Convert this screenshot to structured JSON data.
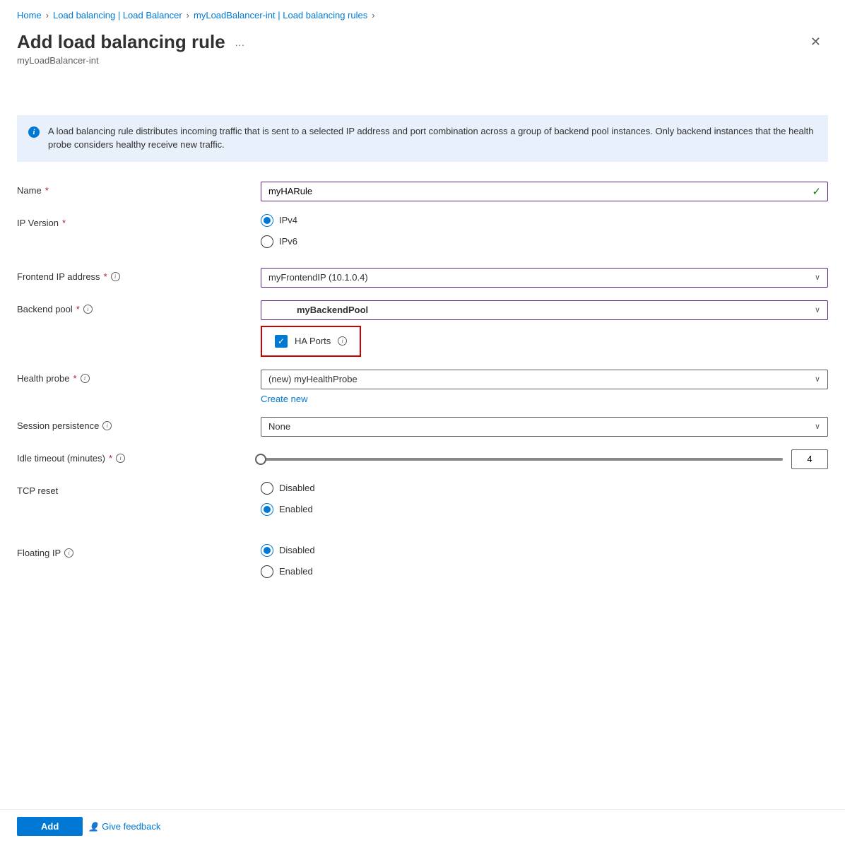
{
  "breadcrumb": {
    "home": "Home",
    "b1": "Load balancing | Load Balancer",
    "b2": "myLoadBalancer-int | Load balancing rules"
  },
  "header": {
    "title": "Add load balancing rule",
    "subtitle": "myLoadBalancer-int"
  },
  "info": {
    "text": "A load balancing rule distributes incoming traffic that is sent to a selected IP address and port combination across a group of backend pool instances. Only backend instances that the health probe considers healthy receive new traffic."
  },
  "form": {
    "name_label": "Name",
    "name_value": "myHARule",
    "ip_version_label": "IP Version",
    "ipv4": "IPv4",
    "ipv6": "IPv6",
    "frontend_label": "Frontend IP address",
    "frontend_value": "myFrontendIP (10.1.0.4)",
    "backend_label": "Backend pool",
    "backend_value": "myBackendPool",
    "ha_label": "HA Ports",
    "health_label": "Health probe",
    "health_value": "(new) myHealthProbe",
    "create_new": "Create new",
    "session_label": "Session persistence",
    "session_value": "None",
    "idle_label": "Idle timeout (minutes)",
    "idle_value": "4",
    "tcp_label": "TCP reset",
    "disabled": "Disabled",
    "enabled": "Enabled",
    "floating_label": "Floating IP"
  },
  "footer": {
    "add": "Add",
    "feedback": "Give feedback"
  }
}
